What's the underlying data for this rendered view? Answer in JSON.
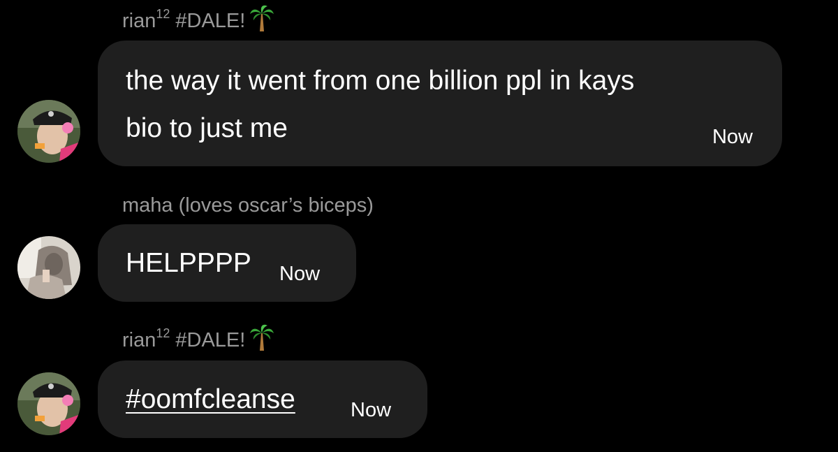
{
  "colors": {
    "background": "#000000",
    "bubble": "#1f1f1f",
    "sender_text": "#9a9a9a",
    "message_text": "#ffffff"
  },
  "messages": [
    {
      "sender": {
        "name": "rian",
        "sup": "12",
        "tag": "#DALE!",
        "emoji": "palm-tree-icon"
      },
      "avatar": "avatar-rian",
      "text_line1": "the way it went from one billion ppl in kays",
      "text_line2": "bio to just me",
      "time": "Now"
    },
    {
      "sender": {
        "name": "maha (loves oscar’s biceps)"
      },
      "avatar": "avatar-maha",
      "text": "HELPPPP",
      "time": "Now"
    },
    {
      "sender": {
        "name": "rian",
        "sup": "12",
        "tag": "#DALE!",
        "emoji": "palm-tree-icon"
      },
      "avatar": "avatar-rian",
      "text": "#oomfcleanse",
      "time": "Now"
    }
  ]
}
